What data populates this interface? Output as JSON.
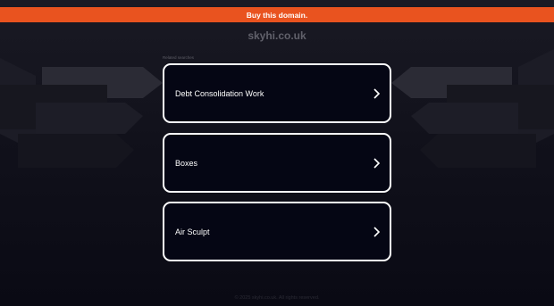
{
  "banner": {
    "label": "Buy this domain."
  },
  "site": {
    "domain": "skyhi.co.uk"
  },
  "related": {
    "heading": "Related searches",
    "items": [
      {
        "label": "Debt Consolidation Work"
      },
      {
        "label": "Boxes"
      },
      {
        "label": "Air Sculpt"
      }
    ]
  },
  "footer": {
    "text": "© 2025 skyhi.co.uk. All rights reserved."
  },
  "colors": {
    "banner_bg": "#e9531f",
    "card_border": "#ffffff",
    "card_bg": "#050614",
    "page_bg": "#11111b"
  }
}
